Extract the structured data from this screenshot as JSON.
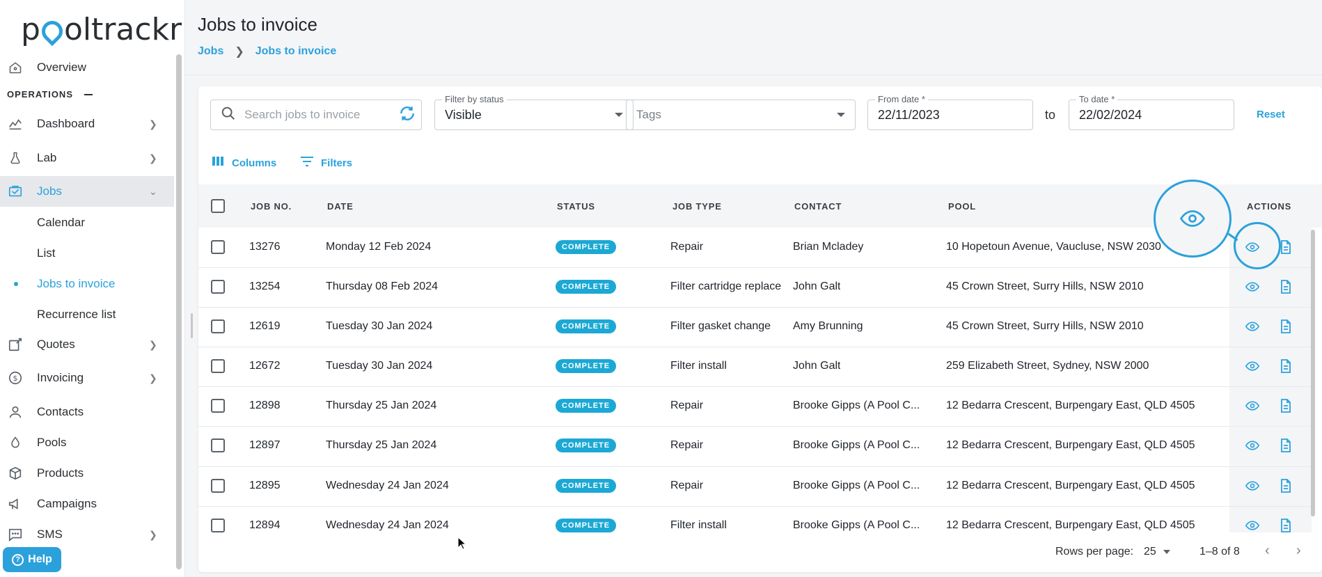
{
  "brand": {
    "name": "pooltrackr",
    "accent": "#2ba1dc"
  },
  "sidebar": {
    "overview": "Overview",
    "section": "OPERATIONS",
    "items": [
      {
        "label": "Dashboard",
        "icon": "chart-line-icon"
      },
      {
        "label": "Lab",
        "icon": "flask-icon"
      },
      {
        "label": "Jobs",
        "icon": "jobs-icon"
      },
      {
        "label": "Quotes",
        "icon": "quote-icon"
      },
      {
        "label": "Invoicing",
        "icon": "dollar-icon"
      },
      {
        "label": "Contacts",
        "icon": "person-icon"
      },
      {
        "label": "Pools",
        "icon": "drop-icon"
      },
      {
        "label": "Products",
        "icon": "box-icon"
      },
      {
        "label": "Campaigns",
        "icon": "megaphone-icon"
      },
      {
        "label": "SMS",
        "icon": "message-icon"
      }
    ],
    "jobs_sub": [
      "Calendar",
      "List",
      "Jobs to invoice",
      "Recurrence list"
    ],
    "help": "Help"
  },
  "header": {
    "title": "Jobs to invoice",
    "breadcrumb": [
      "Jobs",
      "Jobs to invoice"
    ]
  },
  "filters": {
    "search_placeholder": "Search jobs to invoice",
    "status_label": "Filter by status",
    "status_value": "Visible",
    "tags_placeholder": "Tags",
    "from_label": "From date *",
    "from_value": "22/11/2023",
    "to_word": "to",
    "to_label": "To date *",
    "to_value": "22/02/2024",
    "reset": "Reset",
    "columns": "Columns",
    "filters": "Filters"
  },
  "table": {
    "headers": [
      "JOB NO.",
      "DATE",
      "STATUS",
      "JOB TYPE",
      "CONTACT",
      "POOL",
      "ACTIONS"
    ],
    "rows": [
      {
        "job": "13276",
        "date": "Monday 12 Feb 2024",
        "status": "COMPLETE",
        "type": "Repair",
        "contact": "Brian Mcladey",
        "pool": "10 Hopetoun Avenue, Vaucluse, NSW 2030"
      },
      {
        "job": "13254",
        "date": "Thursday 08 Feb 2024",
        "status": "COMPLETE",
        "type": "Filter cartridge replace",
        "contact": "John Galt",
        "pool": "45 Crown Street, Surry Hills, NSW 2010"
      },
      {
        "job": "12619",
        "date": "Tuesday 30 Jan 2024",
        "status": "COMPLETE",
        "type": "Filter gasket change",
        "contact": "Amy Brunning",
        "pool": "45 Crown Street, Surry Hills, NSW 2010"
      },
      {
        "job": "12672",
        "date": "Tuesday 30 Jan 2024",
        "status": "COMPLETE",
        "type": "Filter install",
        "contact": "John Galt",
        "pool": "259 Elizabeth Street, Sydney, NSW 2000"
      },
      {
        "job": "12898",
        "date": "Thursday 25 Jan 2024",
        "status": "COMPLETE",
        "type": "Repair",
        "contact": "Brooke Gipps (A Pool C...",
        "pool": "12 Bedarra Crescent, Burpengary East, QLD 4505"
      },
      {
        "job": "12897",
        "date": "Thursday 25 Jan 2024",
        "status": "COMPLETE",
        "type": "Repair",
        "contact": "Brooke Gipps (A Pool C...",
        "pool": "12 Bedarra Crescent, Burpengary East, QLD 4505"
      },
      {
        "job": "12895",
        "date": "Wednesday 24 Jan 2024",
        "status": "COMPLETE",
        "type": "Repair",
        "contact": "Brooke Gipps (A Pool C...",
        "pool": "12 Bedarra Crescent, Burpengary East, QLD 4505"
      },
      {
        "job": "12894",
        "date": "Wednesday 24 Jan 2024",
        "status": "COMPLETE",
        "type": "Filter install",
        "contact": "Brooke Gipps (A Pool C...",
        "pool": "12 Bedarra Crescent, Burpengary East, QLD 4505"
      }
    ]
  },
  "pagination": {
    "rows_label": "Rows per page:",
    "rows_value": "25",
    "range": "1–8 of 8"
  }
}
